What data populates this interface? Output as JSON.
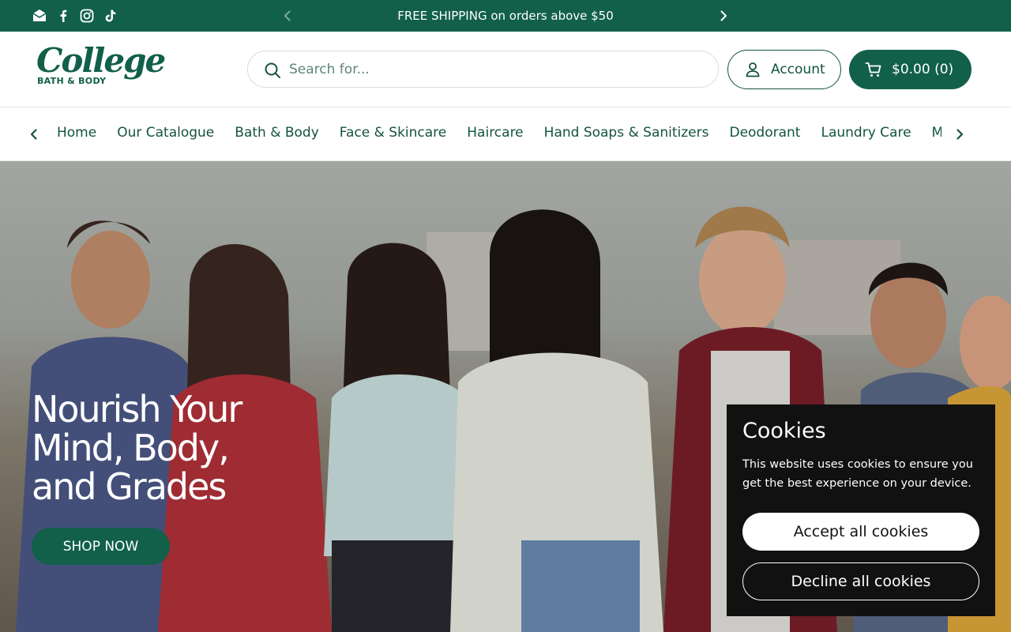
{
  "announcement": {
    "text": "FREE SHIPPING on orders above $50",
    "social_icons": [
      "email-icon",
      "facebook-icon",
      "instagram-icon",
      "tiktok-icon"
    ]
  },
  "header": {
    "logo_script": "College",
    "logo_sub": "BATH & BODY",
    "search_placeholder": "Search for...",
    "account_label": "Account",
    "cart_label": "$0.00 (0)"
  },
  "nav": {
    "items": [
      "Home",
      "Our Catalogue",
      "Bath & Body",
      "Face & Skincare",
      "Haircare",
      "Hand Soaps & Sanitizers",
      "Deodorant",
      "Laundry Care",
      "Men's"
    ]
  },
  "hero": {
    "title_lines": [
      "Nourish Your",
      "Mind, Body,",
      "and Grades"
    ],
    "button_label": "SHOP NOW"
  },
  "cookie": {
    "title": "Cookies",
    "text": "This website uses cookies to ensure you get the best experience on your device.",
    "accept_label": "Accept all cookies",
    "decline_label": "Decline all cookies"
  },
  "colors": {
    "brand_green": "#12604a",
    "text_green": "#13533f",
    "cookie_bg": "#111111"
  }
}
